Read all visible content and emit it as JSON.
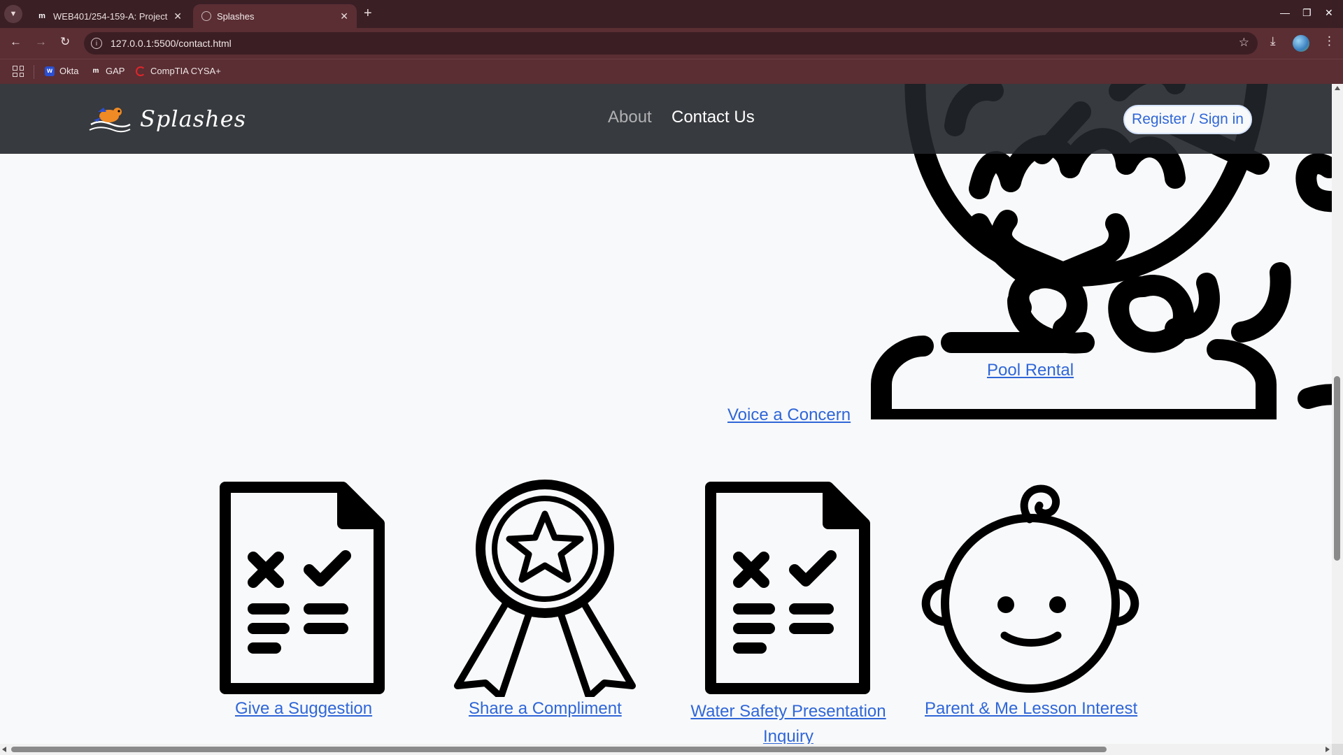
{
  "browser": {
    "tabs": [
      {
        "title": "WEB401/254-159-A: Project",
        "favicon": "moodle-icon",
        "active": false
      },
      {
        "title": "Splashes",
        "favicon": "globe-icon",
        "active": true
      }
    ],
    "url": "127.0.0.1:5500/contact.html",
    "bookmarks": [
      {
        "label": "Okta",
        "icon": "okta-icon"
      },
      {
        "label": "GAP",
        "icon": "moodle-icon"
      },
      {
        "label": "CompTIA CYSA+",
        "icon": "comptia-icon"
      }
    ]
  },
  "site": {
    "brand": "Splashes",
    "nav": {
      "about": "About",
      "contact": "Contact Us"
    },
    "register_label": "Register / Sign in"
  },
  "contact": {
    "pool_rental": "Pool Rental",
    "voice_concern": "Voice a Concern",
    "cards": [
      {
        "label": "Give a Suggestion",
        "icon": "checklist-document-icon"
      },
      {
        "label": "Share a Compliment",
        "icon": "award-ribbon-icon"
      },
      {
        "label_line1": "Water Safety Presentation",
        "label_line2": "Inquiry",
        "icon": "checklist-document-icon"
      },
      {
        "label": "Parent & Me Lesson Interest",
        "icon": "baby-face-icon"
      }
    ]
  },
  "colors": {
    "chrome_dark": "#3a1f25",
    "chrome_mid": "#5a2e33",
    "navbar": "#212529",
    "link": "#2f66d8",
    "page_bg": "#f8f9fa"
  }
}
